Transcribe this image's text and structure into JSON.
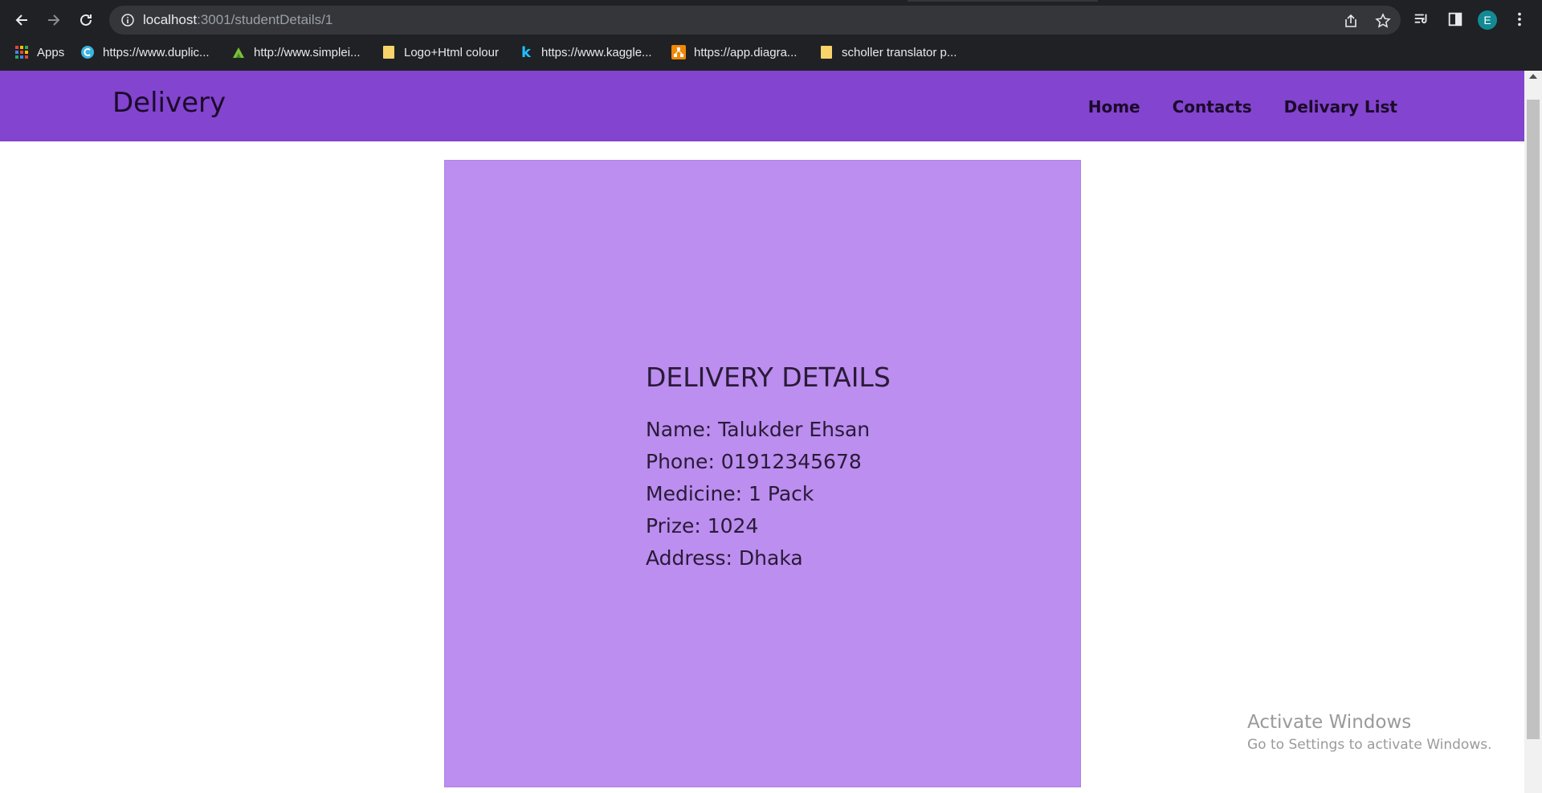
{
  "browser": {
    "url_host": "localhost",
    "url_path": ":3001/studentDetails/1",
    "avatar_letter": "E",
    "bookmarks": [
      {
        "label": "Apps",
        "icon": "apps-grid-icon"
      },
      {
        "label": "https://www.duplic...",
        "icon": "site-icon"
      },
      {
        "label": "http://www.simplei...",
        "icon": "site-icon"
      },
      {
        "label": "Logo+Html colour",
        "icon": "folder-icon"
      },
      {
        "label": "https://www.kaggle...",
        "icon": "kaggle-icon"
      },
      {
        "label": "https://app.diagra...",
        "icon": "diagrams-icon"
      },
      {
        "label": "scholler translator p...",
        "icon": "folder-icon"
      }
    ]
  },
  "nav": {
    "brand": "Delivery",
    "links": [
      "Home",
      "Contacts",
      "Delivary List"
    ]
  },
  "details": {
    "title": "DELIVERY DETAILS",
    "name": "Name: Talukder Ehsan",
    "phone": "Phone: 01912345678",
    "medicine": "Medicine: 1 Pack",
    "prize": "Prize: 1024",
    "address": "Address: Dhaka"
  },
  "watermark": {
    "title": "Activate Windows",
    "subtitle": "Go to Settings to activate Windows."
  },
  "colors": {
    "navbar": "#8344cf",
    "card": "#bb8eef",
    "chrome": "#202124"
  }
}
